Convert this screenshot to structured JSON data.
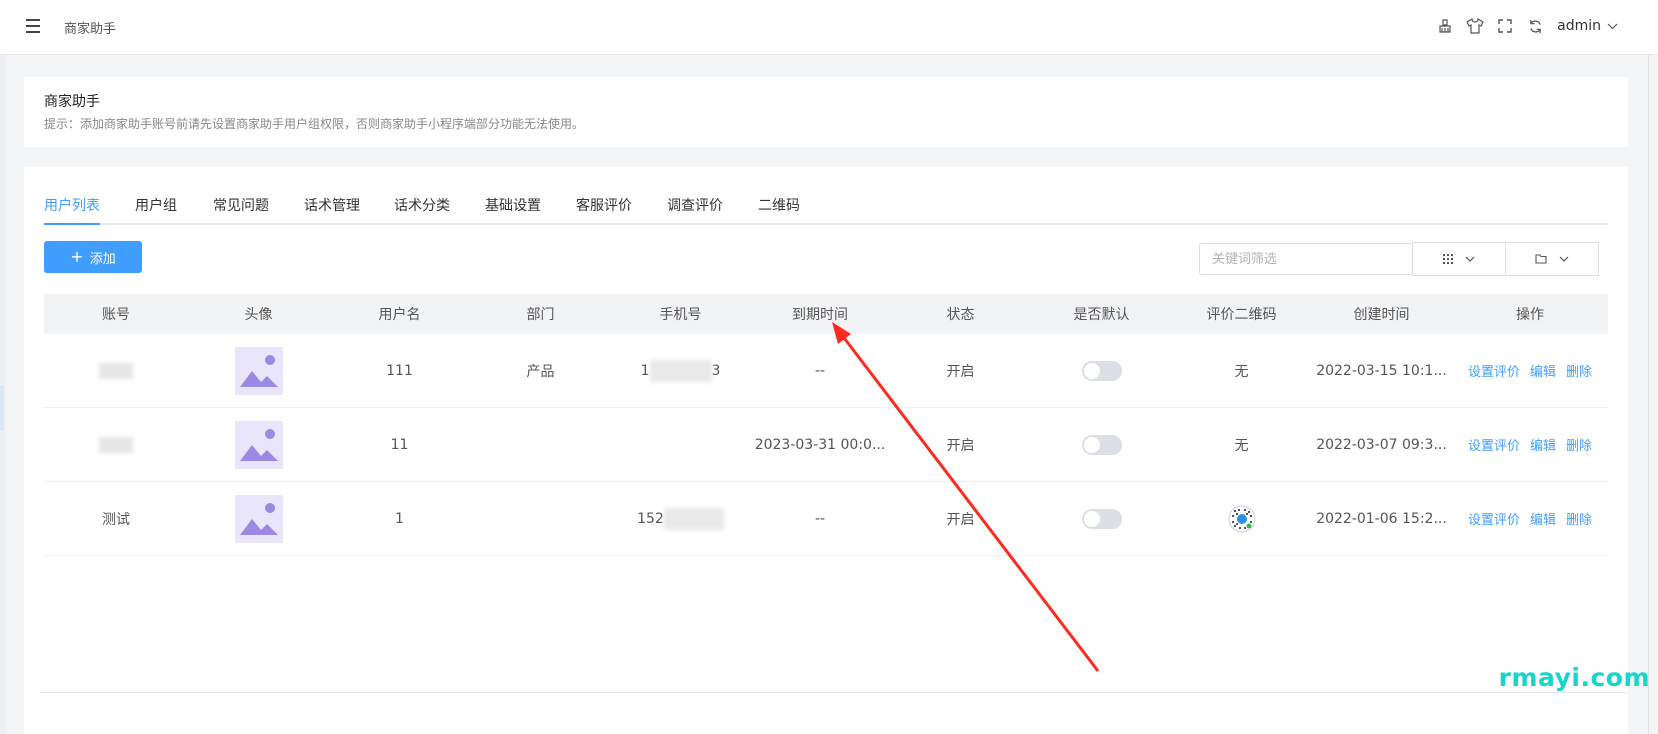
{
  "header": {
    "breadcrumb": "商家助手",
    "user": "admin",
    "icons": [
      "clean-icon",
      "skin-icon",
      "fullscreen-icon",
      "refresh-icon"
    ]
  },
  "notice": {
    "title": "商家助手",
    "text": "提示：添加商家助手账号前请先设置商家助手用户组权限，否则商家助手小程序端部分功能无法使用。"
  },
  "tabs": [
    "用户列表",
    "用户组",
    "常见问题",
    "话术管理",
    "话术分类",
    "基础设置",
    "客服评价",
    "调查评价",
    "二维码"
  ],
  "active_tab": 0,
  "toolbar": {
    "add_label": "添加",
    "search_placeholder": "关键词筛选"
  },
  "table": {
    "columns": [
      "账号",
      "头像",
      "用户名",
      "部门",
      "手机号",
      "到期时间",
      "状态",
      "是否默认",
      "评价二维码",
      "创建时间",
      "操作"
    ],
    "rows": [
      {
        "account": "",
        "username": "111",
        "department": "产品",
        "phone_start": "1",
        "phone_end": "3",
        "expire": "--",
        "status": "开启",
        "default": false,
        "qr": "无",
        "created": "2022-03-15 10:1...",
        "has_qr_image": false
      },
      {
        "account": "",
        "username": "11",
        "department": "",
        "phone_start": "",
        "phone_end": "",
        "expire": "2023-03-31 00:0...",
        "status": "开启",
        "default": false,
        "qr": "无",
        "created": "2022-03-07 09:3...",
        "has_qr_image": false
      },
      {
        "account": "测试",
        "username": "1",
        "department": "",
        "phone_start": "152",
        "phone_end": "",
        "expire": "--",
        "status": "开启",
        "default": false,
        "qr": "",
        "created": "2022-01-06 15:2...",
        "has_qr_image": true
      }
    ],
    "actions": [
      "设置评价",
      "编辑",
      "删除"
    ]
  },
  "watermark": "rmayi.com",
  "accent_color": "#409eff",
  "annotation_color": "#ff2a1f"
}
